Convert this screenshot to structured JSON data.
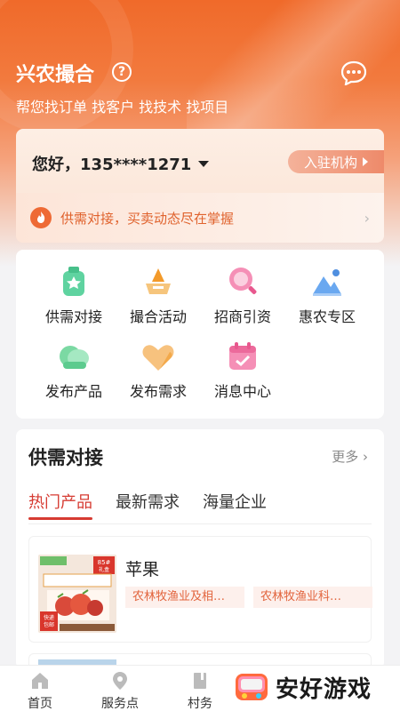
{
  "header": {
    "app_title": "兴农撮合",
    "help_glyph": "?",
    "subtitle": "帮您找订单 找客户 找技术 找项目"
  },
  "user_card": {
    "greeting": "您好，135****1271",
    "join_button": "入驻机构",
    "ticker_text": "供需对接，买卖动态尽在掌握",
    "chevron": "›"
  },
  "quick_menu": [
    {
      "label": "供需对接",
      "icon": "supply-demand-icon"
    },
    {
      "label": "撮合活动",
      "icon": "activity-icon"
    },
    {
      "label": "招商引资",
      "icon": "investment-icon"
    },
    {
      "label": "惠农专区",
      "icon": "benefit-zone-icon"
    },
    {
      "label": "发布产品",
      "icon": "publish-product-icon"
    },
    {
      "label": "发布需求",
      "icon": "publish-demand-icon"
    },
    {
      "label": "消息中心",
      "icon": "message-center-icon"
    }
  ],
  "supply_section": {
    "title": "供需对接",
    "more": "更多 ›",
    "tabs": [
      "热门产品",
      "最新需求",
      "海量企业"
    ],
    "active_tab": 0,
    "products": [
      {
        "name": "苹果",
        "tags": [
          "农林牧渔业及相…",
          "农林牧渔业科…"
        ],
        "image_badges": {
          "top_right": "85#",
          "top_right_2": "礼盒",
          "bottom_left": "快递",
          "bottom_left_2": "包邮"
        }
      }
    ]
  },
  "bottom_nav": [
    {
      "label": "首页",
      "icon": "home-icon"
    },
    {
      "label": "服务点",
      "icon": "location-pin-icon"
    },
    {
      "label": "村务",
      "icon": "book-icon"
    }
  ],
  "watermark": {
    "text": "安好游戏"
  },
  "colors": {
    "brand_orange": "#f06a2a",
    "active_red": "#d63b32",
    "tag_text": "#e2643d"
  }
}
